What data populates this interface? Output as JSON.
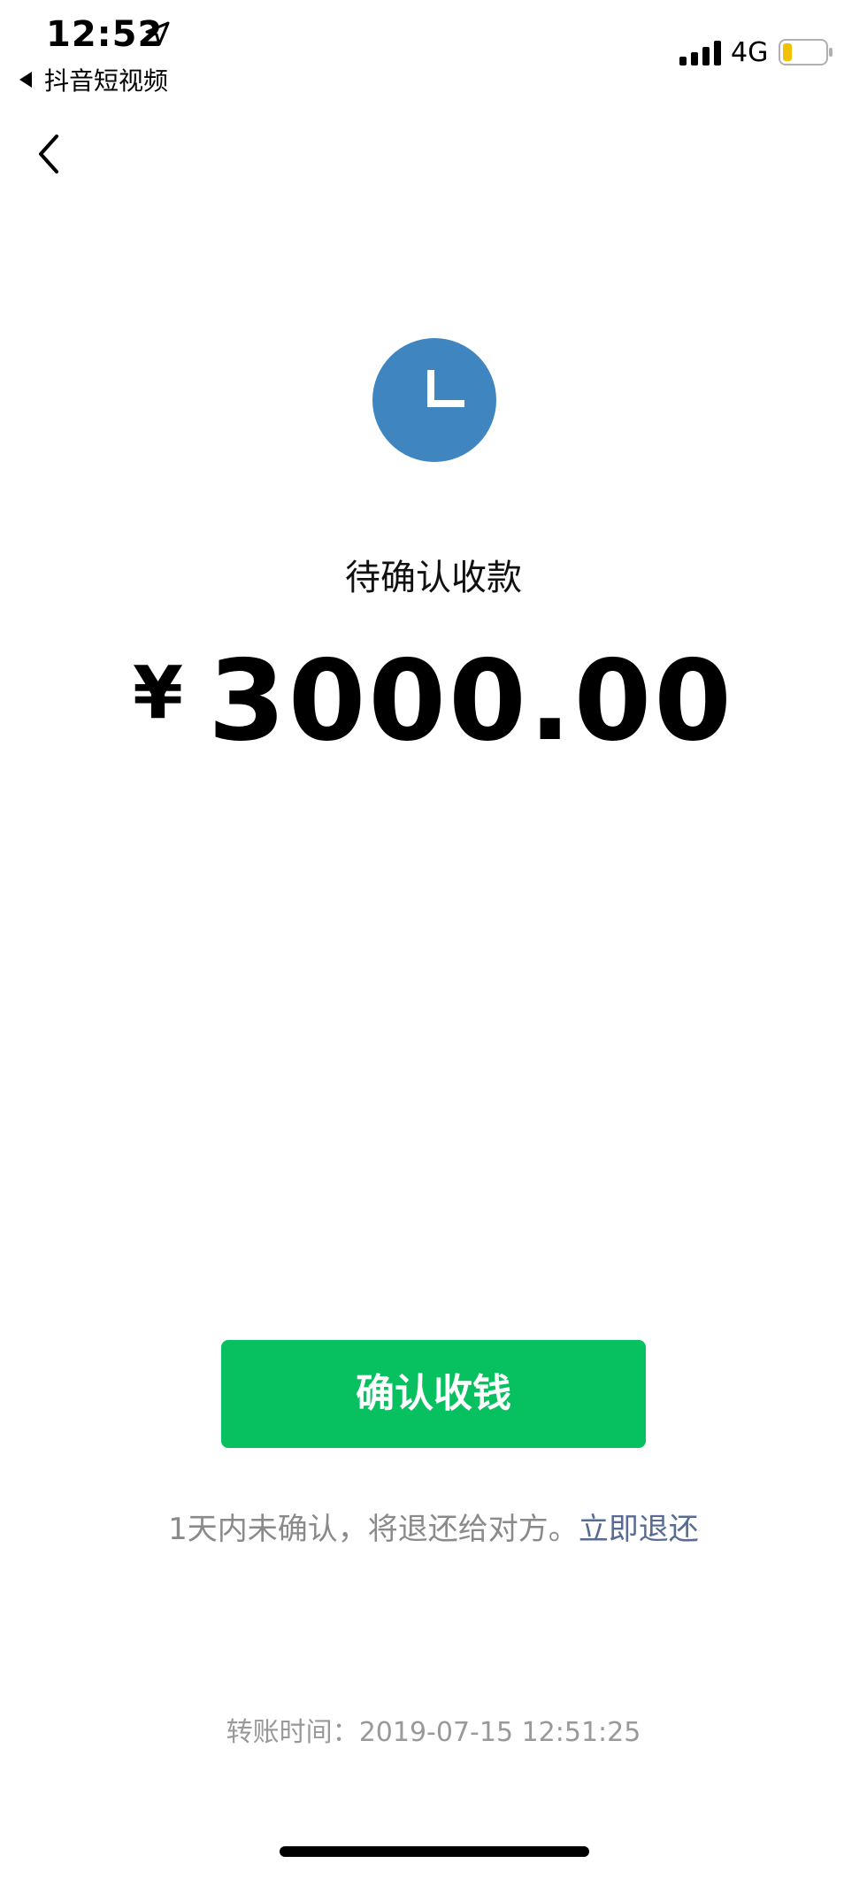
{
  "status_bar": {
    "time": "12:52",
    "back_app_label": "抖音短视频",
    "network": "4G",
    "icons": [
      "location-arrow-icon",
      "signal-icon",
      "battery-icon"
    ]
  },
  "nav": {
    "back_icon": "chevron-left-icon"
  },
  "main": {
    "status_icon": "clock-icon",
    "status_icon_color": "#3f85c0",
    "status_title": "待确认收款",
    "currency_symbol": "¥",
    "amount": "3000.00"
  },
  "actions": {
    "confirm_label": "确认收钱",
    "confirm_color": "#07c160",
    "notice_text": "1天内未确认，将退还给对方。",
    "refund_link": "立即退还",
    "link_color": "#576b95"
  },
  "footer": {
    "transfer_time_label": "转账时间：",
    "transfer_time_value": "2019-07-15 12:51:25"
  }
}
